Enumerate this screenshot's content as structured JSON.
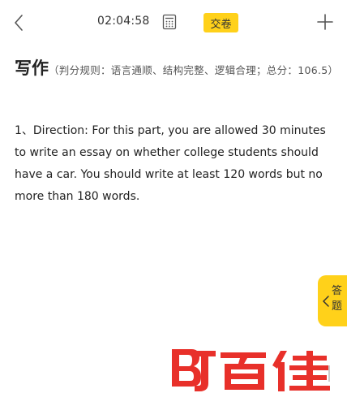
{
  "topbar": {
    "timer": "02:04:58",
    "submit_label": "交卷"
  },
  "section": {
    "title": "写作",
    "rule": "（判分规则：语言通顺、结构完整、逻辑合理；总分：106.5）"
  },
  "question": {
    "text": "1、Direction: For this part, you are allowed 30 minutes to write an essay on whether college students should have a car. You should write at least 120 words but no more than 180 words."
  },
  "answer_tab": {
    "label": "答题"
  },
  "watermark": {
    "brand_text": "百佳",
    "mark_letters": "BJ"
  },
  "colors": {
    "accent": "#ffd11a",
    "watermark_red": "#e8302a",
    "text": "#222222"
  },
  "icons": {
    "back": "chevron-left-icon",
    "calculator": "calculator-icon",
    "add": "plus-icon",
    "tab": "chevron-left-icon"
  }
}
